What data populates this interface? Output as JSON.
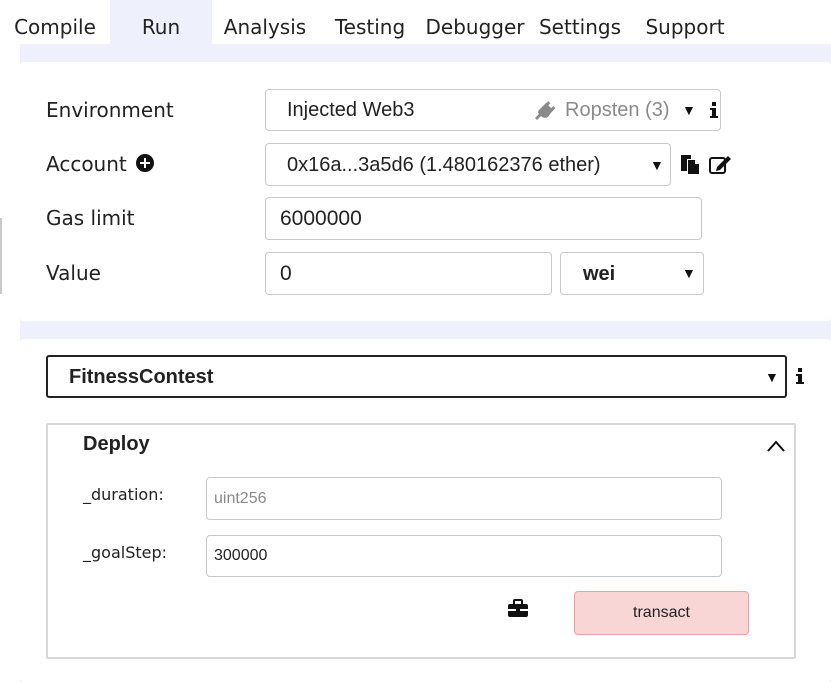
{
  "tabs": [
    {
      "label": "Compile"
    },
    {
      "label": "Run"
    },
    {
      "label": "Analysis"
    },
    {
      "label": "Testing"
    },
    {
      "label": "Debugger"
    },
    {
      "label": "Settings"
    },
    {
      "label": "Support"
    }
  ],
  "active_tab": "Run",
  "environment": {
    "label": "Environment",
    "value": "Injected Web3",
    "network": "Ropsten (3)",
    "network_icon": "plug-icon",
    "info_icon": "info-icon"
  },
  "account": {
    "label": "Account",
    "add_icon": "plus-circle-icon",
    "value": "0x16a...3a5d6 (1.480162376 ether)",
    "copy_icon": "copy-icon",
    "sign_icon": "edit-icon"
  },
  "gas_limit": {
    "label": "Gas limit",
    "value": "6000000"
  },
  "value_field": {
    "label": "Value",
    "value": "0",
    "unit": "wei"
  },
  "contract": {
    "selected": "FitnessContest",
    "info_icon": "info-icon"
  },
  "deploy": {
    "title": "Deploy",
    "params": [
      {
        "label": "_duration:",
        "value": "",
        "placeholder": "uint256"
      },
      {
        "label": "_goalStep:",
        "value": "300000",
        "placeholder": ""
      }
    ],
    "button_label": "transact",
    "briefcase_icon": "briefcase-icon"
  },
  "colors": {
    "panel_bg": "#eef0fb",
    "transact_bg": "#f9d6d6",
    "transact_border": "#e8a4a4"
  }
}
